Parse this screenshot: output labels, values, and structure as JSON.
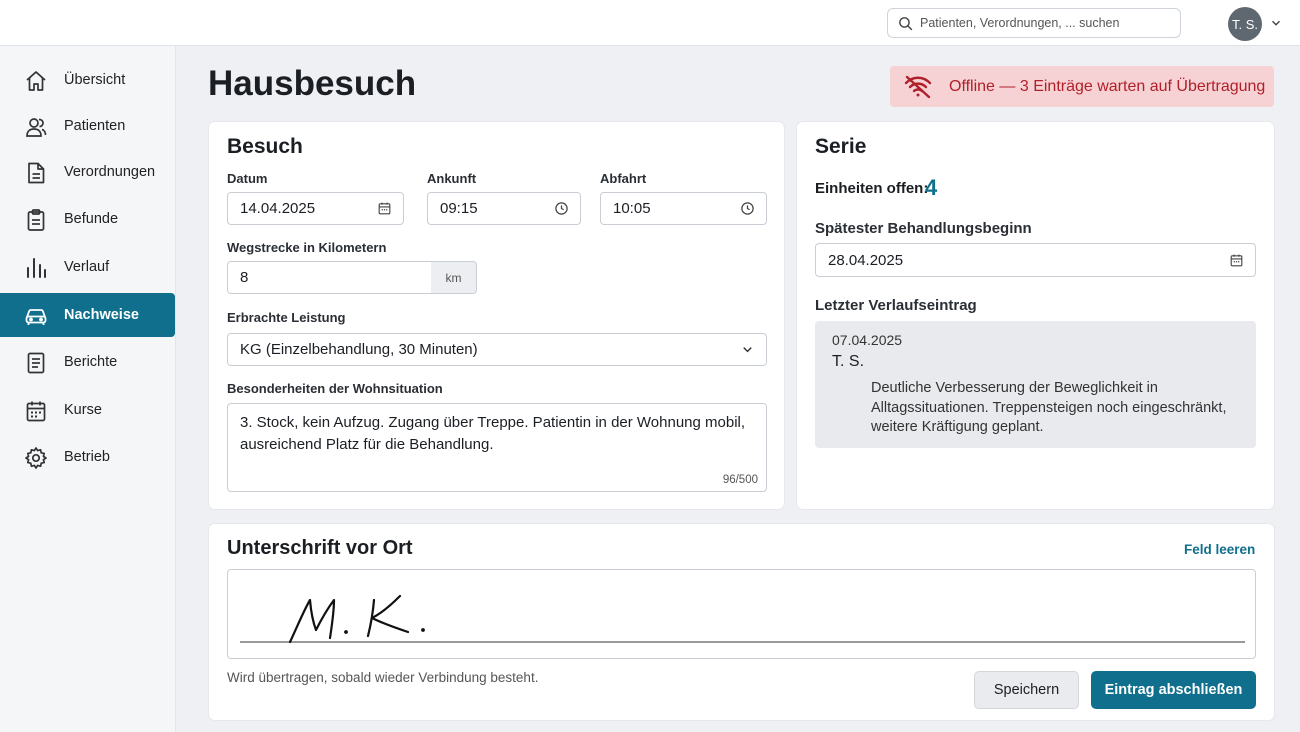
{
  "header": {
    "search_placeholder": "Patienten, Verordnungen, ... suchen",
    "user_initials": "T. S."
  },
  "sidebar": {
    "items": [
      {
        "label": "Übersicht",
        "icon": "home-icon"
      },
      {
        "label": "Patienten",
        "icon": "users-icon"
      },
      {
        "label": "Verordnungen",
        "icon": "document-icon"
      },
      {
        "label": "Befunde",
        "icon": "clipboard-icon"
      },
      {
        "label": "Verlauf",
        "icon": "chart-icon"
      },
      {
        "label": "Nachweise",
        "icon": "car-icon",
        "active": true
      },
      {
        "label": "Berichte",
        "icon": "report-icon"
      },
      {
        "label": "Kurse",
        "icon": "calendar-icon"
      },
      {
        "label": "Betrieb",
        "icon": "gear-icon"
      }
    ]
  },
  "page": {
    "title": "Hausbesuch",
    "offline_banner": "Offline — 3 Einträge warten auf Übertragung"
  },
  "visit": {
    "title": "Besuch",
    "date_label": "Datum",
    "date_value": "14.04.2025",
    "arrival_label": "Ankunft",
    "arrival_value": "09:15",
    "departure_label": "Abfahrt",
    "departure_value": "10:05",
    "distance_label": "Wegstrecke in Kilometern",
    "distance_value": "8",
    "distance_unit": "km",
    "service_label": "Erbrachte Leistung",
    "service_value": "KG (Einzelbehandlung, 30 Minuten)",
    "notes_label": "Besonderheiten der Wohnsituation",
    "notes_value": "3. Stock, kein Aufzug. Zugang über Treppe. Patientin in der Wohnung mobil, ausreichend Platz für die Behandlung.",
    "notes_counter": "96/500"
  },
  "series": {
    "title": "Serie",
    "open_units_label": "Einheiten offen:",
    "open_units_value": "4",
    "latest_start_label": "Spätester Behandlungsbeginn",
    "latest_start_value": "28.04.2025",
    "last_log_label": "Letzter Verlaufseintrag",
    "last_log_date": "07.04.2025",
    "last_log_author": "T. S.",
    "last_log_text": "Deutliche Verbesserung der Beweglichkeit in Alltagssituationen. Treppensteigen noch eingeschränkt, weitere Kräftigung geplant."
  },
  "signature": {
    "title": "Unterschrift vor Ort",
    "clear_link": "Feld leeren",
    "signed_text": "M. K.",
    "note": "Wird übertragen, sobald wieder Verbindung besteht.",
    "save_button": "Speichern",
    "submit_button": "Eintrag abschließen"
  },
  "colors": {
    "accent": "#0f6f8c",
    "banner_bg": "#f7d2d4",
    "banner_text": "#b0202a"
  }
}
